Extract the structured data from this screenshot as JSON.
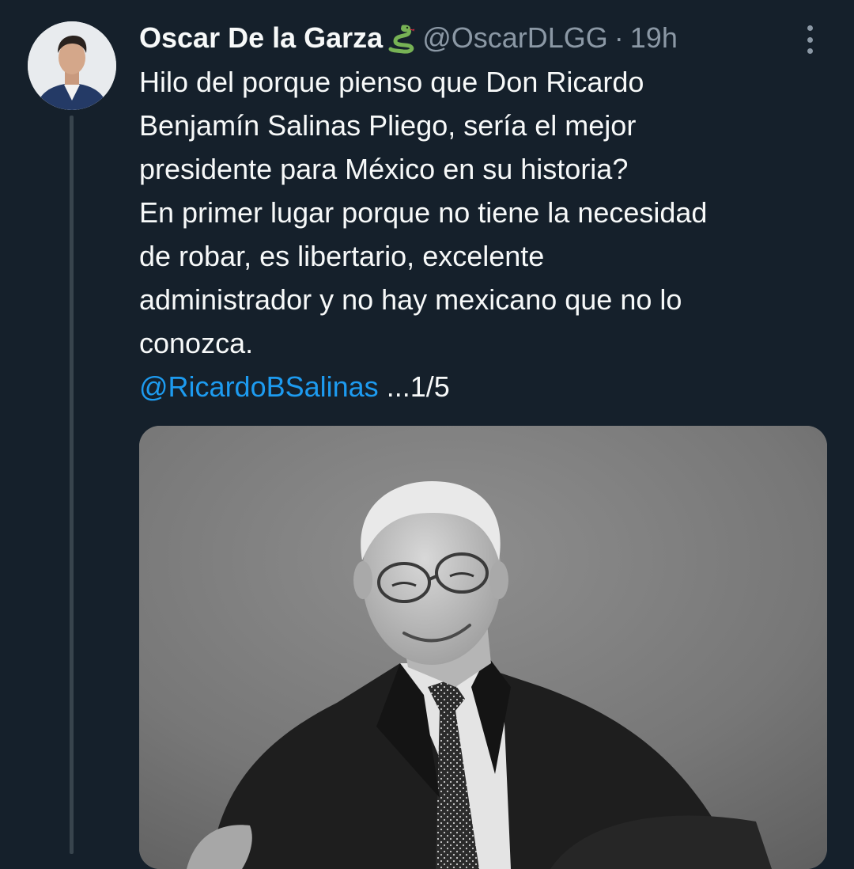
{
  "tweet": {
    "author": {
      "display_name": "Oscar De la Garza",
      "emoji": "🐍",
      "handle": "@OscarDLGG",
      "separator": "·",
      "timestamp": "19h"
    },
    "text_lines": [
      "Hilo del porque pienso que Don Ricardo",
      "Benjamín Salinas Pliego, sería el mejor",
      "presidente para México en su historia?",
      "En primer lugar porque no tiene la necesidad",
      "de robar, es libertario, excelente",
      "administrador y no hay mexicano que no lo",
      "conozca."
    ],
    "mention": "@RicardoBSalinas",
    "thread_counter": "...1/5",
    "icons": {
      "more": "more-vertical-icon",
      "emoji": "snake-icon"
    },
    "colors": {
      "background": "#15202b",
      "text": "#f7f9f9",
      "secondary": "#8b98a5",
      "link": "#1d9bf0",
      "thread_line": "#38444d"
    }
  }
}
